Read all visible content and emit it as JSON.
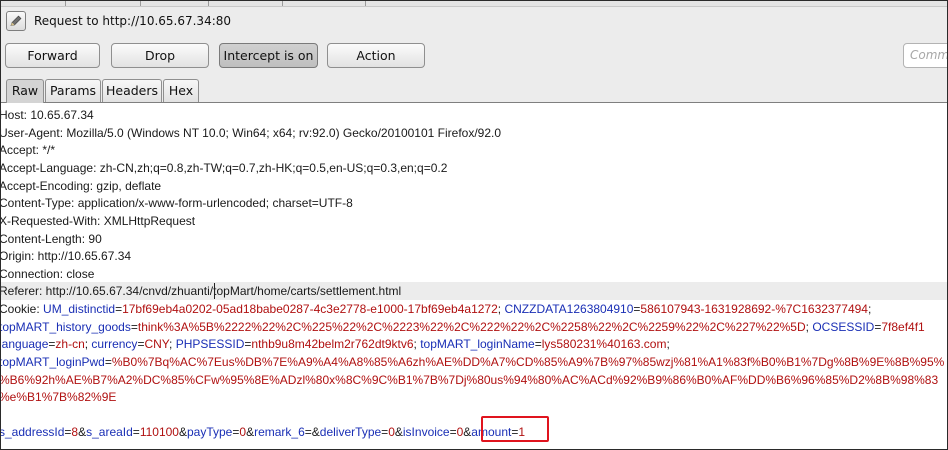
{
  "request_bar": {
    "label": "Request to http://10.65.67.34:80"
  },
  "toolbar": {
    "forward": "Forward",
    "drop": "Drop",
    "intercept": "Intercept is on",
    "action": "Action",
    "comment_placeholder": "Comment"
  },
  "tabs": [
    "Raw",
    "Params",
    "Headers",
    "Hex"
  ],
  "request": {
    "host": "Host: 10.65.67.34",
    "user_agent": "User-Agent: Mozilla/5.0 (Windows NT 10.0; Win64; x64; rv:92.0) Gecko/20100101 Firefox/92.0",
    "accept": "Accept: */*",
    "accept_language": "Accept-Language: zh-CN,zh;q=0.8,zh-TW;q=0.7,zh-HK;q=0.5,en-US;q=0.3,en;q=0.2",
    "accept_encoding": "Accept-Encoding: gzip, deflate",
    "content_type": "Content-Type: application/x-www-form-urlencoded; charset=UTF-8",
    "x_requested_with": "X-Requested-With: XMLHttpRequest",
    "content_length": "Content-Length: 90",
    "origin": "Origin: http://10.65.67.34",
    "connection": "Connection: close",
    "referer": "Referer: http://10.65.67.34/cnvd/zhuanti/topMart/home/carts/settlement.html",
    "cookie_line1": {
      "prefix": "Cookie: ",
      "k1": "UM_distinctid",
      "v1": "17bf69eb4a0202-05ad18babe0287-4c3e2778-e1000-17bf69eb4a1272",
      "k2": "CNZZDATA1263804910",
      "v2": "586107943-1631928692-%7C1632377494"
    },
    "cookie_line2": {
      "k1": "topMART_history_goods",
      "v1": "think%3A%5B%2222%22%2C%225%22%2C%2223%22%2C%222%22%2C%2258%22%2C%2259%22%2C%227%22%5D",
      "k2": "OCSESSID",
      "v2": "7f8ef4f1"
    },
    "cookie_line3": {
      "k1": "language",
      "v1": "zh-cn",
      "k2": "currency",
      "v2": "CNY",
      "k3": "PHPSESSID",
      "v3": "nthb9u8m42belm2r762dt9ktv6",
      "k4": "topMART_loginName",
      "v4": "lys580231%40163.com"
    },
    "cookie_line4": {
      "k1": "topMART_loginPwd",
      "v1": "%B0%7Bq%AC%7Eus%DB%7E%A9%A4%A8%85%A6zh%AE%DD%A7%CD%85%A9%7B%97%85wzj%81%A1%83f%B0%B1%7Dg%8B%9E%8B%95%"
    },
    "cookie_line5": "%B6%92h%AE%B7%A2%DC%85%CFw%95%8E%ADzl%80x%8C%9C%B1%7B%7Dj%80us%94%80%AC%ACd%92%B9%86%B0%AF%DD%B6%96%85%D2%8B%98%83",
    "cookie_line6": "%e%B1%7B%82%9E",
    "body": {
      "p1k": "s_addressId",
      "p1v": "8",
      "p2k": "s_areaId",
      "p2v": "110100",
      "p3k": "payType",
      "p3v": "0",
      "p4k": "remark_6",
      "p4v": "",
      "p5k": "deliverType",
      "p5v": "0",
      "p6k": "isInvoice",
      "p6v": "0",
      "p7k": "amount",
      "p7v": "1"
    }
  },
  "colors": {
    "param_name": "#1a2fb5",
    "param_value": "#b01010",
    "highlight_box": "#e0141e"
  }
}
